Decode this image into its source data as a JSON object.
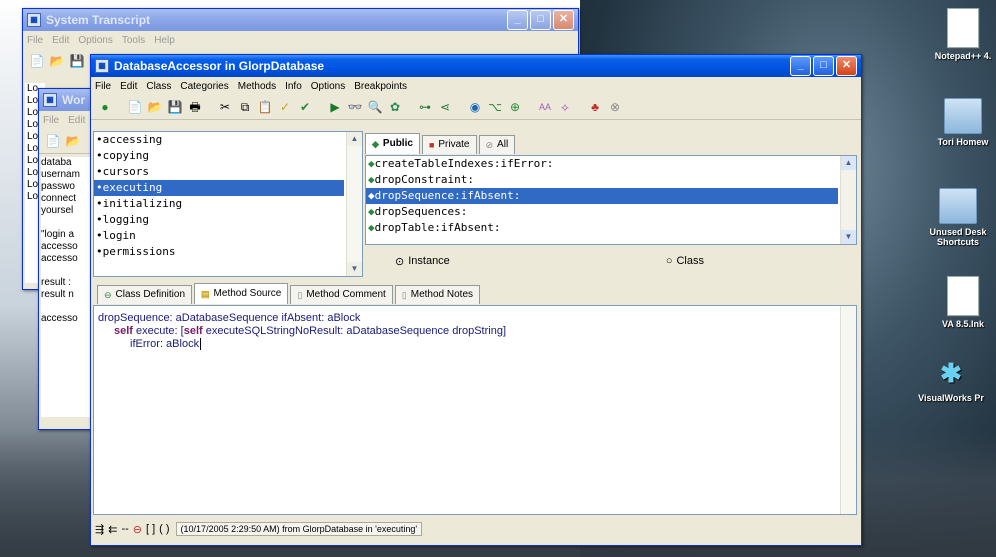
{
  "transcript": {
    "title": "System Transcript",
    "menu": [
      "File",
      "Edit",
      "Options",
      "Tools",
      "Help"
    ],
    "lines": [
      "Lo",
      "Lo",
      "Lo",
      "Lo",
      "Lo",
      "Lo",
      "Lo",
      "Lo",
      "Lo",
      "Lo"
    ]
  },
  "workspace": {
    "title": "Wor",
    "menu": [
      "File",
      "Edit"
    ],
    "lines": [
      "databa",
      "usernam",
      "passwo",
      "connect",
      "yoursel",
      "",
      "\"login a",
      "accesso",
      "accesso",
      "",
      "result :",
      "result n",
      "",
      "accesso"
    ]
  },
  "browser": {
    "title": "DatabaseAccessor in GlorpDatabase",
    "menu": [
      "File",
      "Edit",
      "Class",
      "Categories",
      "Methods",
      "Info",
      "Options",
      "Breakpoints"
    ],
    "categories": [
      "accessing",
      "copying",
      "cursors",
      "executing",
      "initializing",
      "logging",
      "login",
      "permissions"
    ],
    "selected_category": "executing",
    "visibility_tabs": [
      "Public",
      "Private",
      "All"
    ],
    "methods": [
      "createTableIndexes:ifError:",
      "dropConstraint:",
      "dropSequence:ifAbsent:",
      "dropSequences:",
      "dropTable:ifAbsent:"
    ],
    "selected_method": "dropSequence:ifAbsent:",
    "instance_label": "Instance",
    "class_label": "Class",
    "code_tabs": [
      "Class Definition",
      "Method Source",
      "Method Comment",
      "Method Notes"
    ],
    "active_code_tab": "Method Source",
    "source": {
      "line1_sel": "dropSequence: aDatabaseSequence ifAbsent: aBlock",
      "line2_kw": "self",
      "line2_rest": " execute: [",
      "line2_kw2": "self",
      "line2_rest2": " executeSQLStringNoResult: aDatabaseSequence dropString]",
      "line3": "ifError: aBlock"
    },
    "status": "(10/17/2005 2:29:50 AM) from GlorpDatabase in 'executing'"
  },
  "desktop": {
    "icons": [
      "Notepad++ 4.",
      "Tori Homew",
      "Unused Desk Shortcuts",
      "VA 8.5.lnk",
      "VisualWorks Pr"
    ]
  }
}
